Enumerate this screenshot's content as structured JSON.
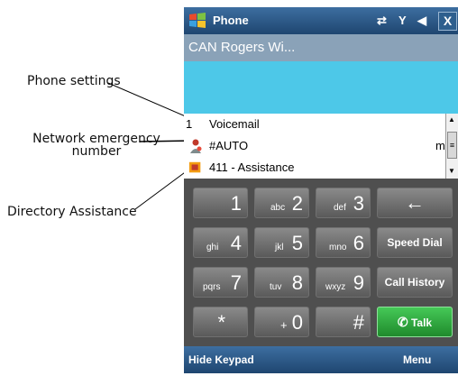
{
  "callouts": {
    "phone_settings": "Phone settings",
    "network_emergency_line1": "Network emergency",
    "network_emergency_line2": "number",
    "directory_assistance": "Directory Assistance"
  },
  "titlebar": {
    "title": "Phone",
    "icons": [
      "start-icon",
      "connectivity-icon",
      "signal-icon",
      "speaker-icon"
    ],
    "close_label": "X"
  },
  "carrier": "CAN Rogers Wi...",
  "list": [
    {
      "label": "1",
      "text": "Voicemail",
      "icon": "none"
    },
    {
      "label": "",
      "text": "#AUTO",
      "icon": "emergency-person-icon",
      "suffix": "m"
    },
    {
      "label": "",
      "text": "411 - Assistance",
      "icon": "assistance-icon"
    }
  ],
  "keys": [
    {
      "letters": "",
      "digit": "1"
    },
    {
      "letters": "abc",
      "digit": "2"
    },
    {
      "letters": "def",
      "digit": "3"
    },
    {
      "letters": "ghi",
      "digit": "4"
    },
    {
      "letters": "jkl",
      "digit": "5"
    },
    {
      "letters": "mno",
      "digit": "6"
    },
    {
      "letters": "pqrs",
      "digit": "7"
    },
    {
      "letters": "tuv",
      "digit": "8"
    },
    {
      "letters": "wxyz",
      "digit": "9"
    },
    {
      "letters": "",
      "digit": "*"
    },
    {
      "letters": "+",
      "digit": "0"
    },
    {
      "letters": "",
      "digit": "#"
    }
  ],
  "function_keys": {
    "backspace": "←",
    "speed_dial": "Speed Dial",
    "call_history": "Call History",
    "talk": "Talk"
  },
  "softkeys": {
    "left": "Hide Keypad",
    "right": "Menu"
  },
  "colors": {
    "titlebar": "#2b5b8a",
    "carrier_bar": "#8aa2b8",
    "dial_display": "#4dc8e8",
    "keypad_bg": "#4f4f4f",
    "talk_button": "#2da63a"
  }
}
